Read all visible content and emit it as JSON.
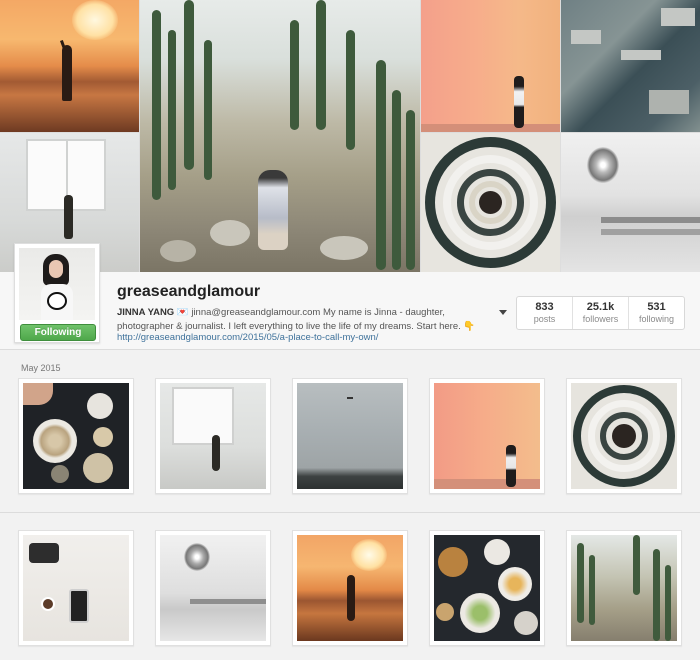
{
  "profile": {
    "username": "greaseandglamour",
    "follow_button": "Following",
    "bio_name": "JINNA YANG",
    "bio_heart": "💌",
    "bio_text": "jinna@greaseandglamour.com My name is Jinna - daughter, photographer & journalist. I left everything to live the life of my dreams. Start here.",
    "bio_hand": "👇",
    "link": "http://greaseandglamour.com/2015/05/a-place-to-call-my-own/"
  },
  "stats": [
    {
      "value": "833",
      "label": "posts"
    },
    {
      "value": "25.1k",
      "label": "followers"
    },
    {
      "value": "531",
      "label": "following"
    }
  ],
  "feed": {
    "month_label": "May 2015"
  },
  "icons": {
    "more": "chevron-down-icon"
  },
  "colors": {
    "follow_green": "#4fa84b",
    "link_blue": "#3f729b",
    "background": "#f2f2f2"
  }
}
